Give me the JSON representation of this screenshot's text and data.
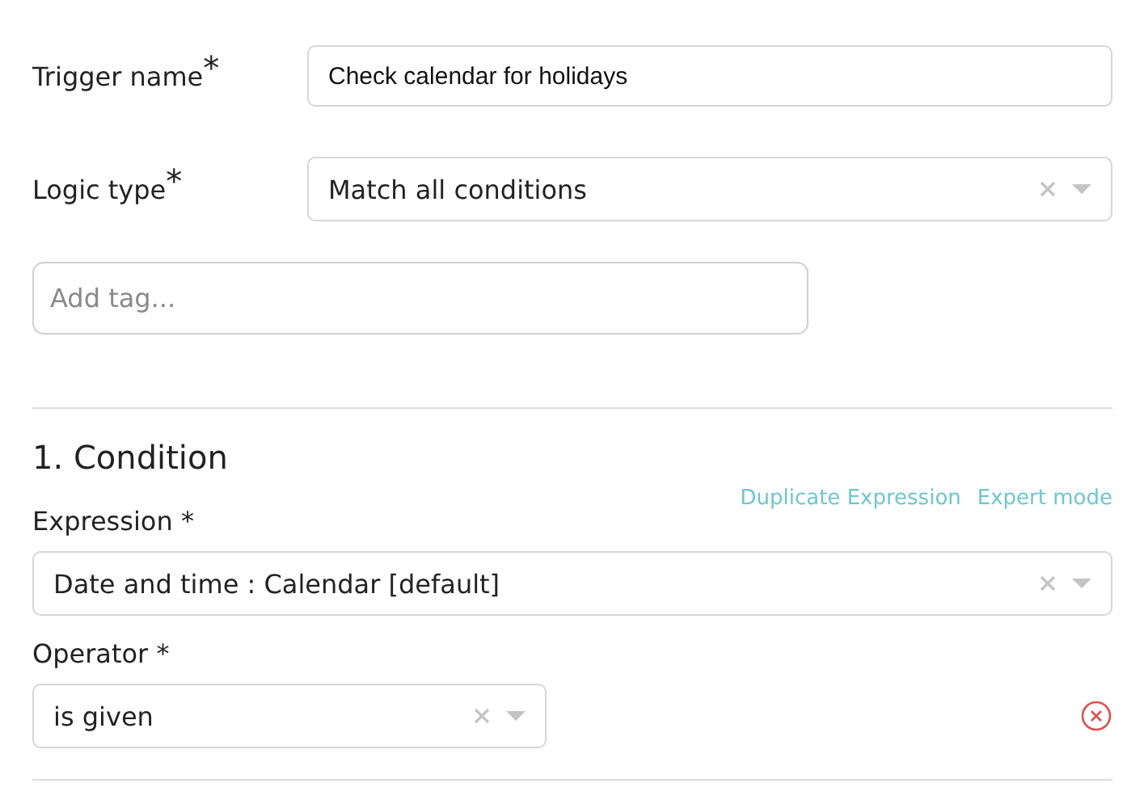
{
  "fields": [
    {
      "kind": "text",
      "label": "Trigger name$^{*}$",
      "value": "Check calendar for holidays"
    },
    {
      "kind": "select",
      "label": "Logic type$^{*}$",
      "value": "Match all conditions"
    }
  ],
  "tags": {
    "placeholder": "Add tag..."
  },
  "condition": {
    "title": "1. Condition",
    "links": [
      "Duplicate Expression",
      "Expert mode"
    ],
    "expression": {
      "label": "Expression *",
      "value": "Date and time : Calendar [default]"
    },
    "operator": {
      "label": "Operator *",
      "value": "is given"
    }
  }
}
